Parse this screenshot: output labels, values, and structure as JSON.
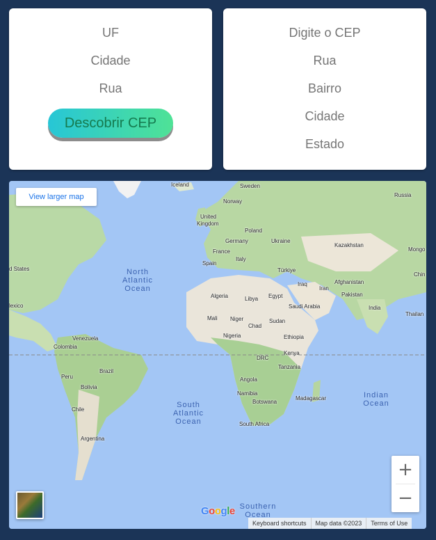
{
  "form_left": {
    "uf_placeholder": "UF",
    "cidade_placeholder": "Cidade",
    "rua_placeholder": "Rua",
    "button_label": "Descobrir CEP"
  },
  "form_right": {
    "cep_placeholder": "Digite o CEP",
    "rua_placeholder": "Rua",
    "bairro_placeholder": "Bairro",
    "cidade_placeholder": "Cidade",
    "estado_placeholder": "Estado"
  },
  "map": {
    "view_larger_label": "View larger map",
    "zoom_in_label": "+",
    "zoom_out_label": "−",
    "logo_letters": [
      "G",
      "o",
      "o",
      "g",
      "l",
      "e"
    ],
    "logo_colors": [
      "#4285F4",
      "#EA4335",
      "#FBBC05",
      "#4285F4",
      "#34A853",
      "#EA4335"
    ],
    "attribution": {
      "shortcuts": "Keyboard shortcuts",
      "map_data": "Map data ©2023",
      "terms": "Terms of Use"
    },
    "oceans": {
      "north_atlantic": [
        "North",
        "Atlantic",
        "Ocean"
      ],
      "south_atlantic": [
        "South",
        "Atlantic",
        "Ocean"
      ],
      "indian": [
        "Indian",
        "Ocean"
      ],
      "southern": [
        "Southern",
        "Ocean"
      ]
    },
    "places": {
      "iceland": "Iceland",
      "sweden": "Sweden",
      "norway": "Norway",
      "russia": "Russia",
      "uk": [
        "United",
        "Kingdom"
      ],
      "poland": "Poland",
      "germany": "Germany",
      "ukraine": "Ukraine",
      "kazakhstan": "Kazakhstan",
      "mongolia": "Mongo",
      "france": "France",
      "italy": "Italy",
      "spain": "Spain",
      "turkiye": "Türkiye",
      "china": "Chin",
      "united_states": "d States",
      "afghanistan": "Afghanistan",
      "iraq": "Iraq",
      "iran": "Iran",
      "algeria": "Algeria",
      "libya": "Libya",
      "egypt": "Egypt",
      "saudi_arabia": "Saudi Arabia",
      "pakistan": "Pakistan",
      "india": "India",
      "thailand": "Thailan",
      "mexico": "lexico",
      "mali": "Mali",
      "niger": "Niger",
      "chad": "Chad",
      "sudan": "Sudan",
      "nigeria": "Nigeria",
      "ethiopia": "Ethiopia",
      "venezuela": "Venezuela",
      "colombia": "Colombia",
      "kenya": "Kenya",
      "drc": "DRC",
      "tanzania": "Tanzania",
      "peru": "Peru",
      "brazil": "Brazil",
      "bolivia": "Bolivia",
      "angola": "Angola",
      "namibia": "Namibia",
      "botswana": "Botswana",
      "madagascar": "Madagascar",
      "chile": "Chile",
      "argentina": "Argentina",
      "south_africa": "South Africa"
    }
  }
}
